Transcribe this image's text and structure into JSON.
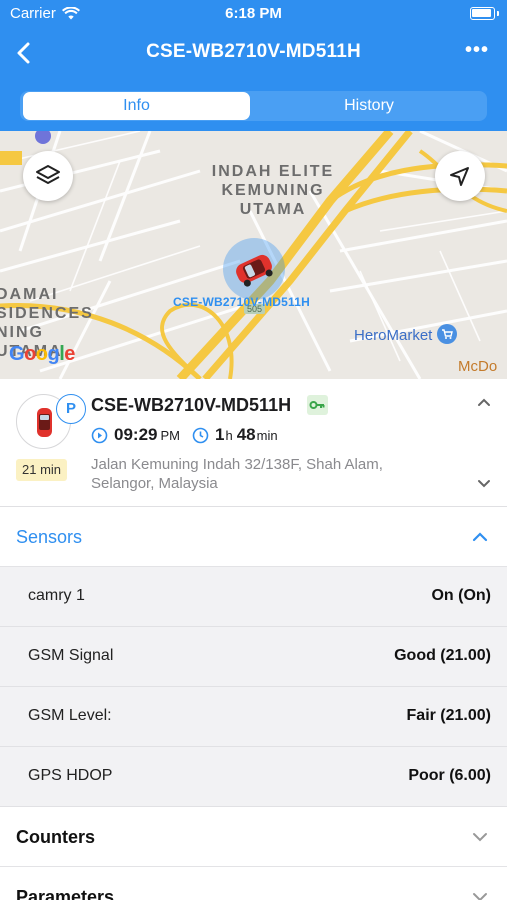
{
  "status_bar": {
    "carrier": "Carrier",
    "time": "6:18 PM"
  },
  "nav": {
    "title": "CSE-WB2710V-MD511H",
    "more": "•••"
  },
  "tabs": [
    {
      "label": "Info",
      "active": true
    },
    {
      "label": "History",
      "active": false
    }
  ],
  "map": {
    "area_a": "INDAH ELITE KEMUNING UTAMA",
    "area_b": "DAMAI SIDENCES NING UTAMA",
    "marker_label": "CSE-WB2710V-MD511H",
    "road_sign": "505",
    "poi_1": "HeroMarket",
    "poi_2": "McDo",
    "attribution": "Google"
  },
  "object": {
    "name": "CSE-WB2710V-MD511H",
    "parking_badge": "P",
    "duration": "21 min",
    "time": "09:29",
    "time_suffix": "PM",
    "stop_hours": "1",
    "stop_hours_unit": "h",
    "stop_minutes": "48",
    "stop_minutes_unit": "min",
    "address": "Jalan Kemuning Indah 32/138F, Shah Alam, Selangor, Malaysia"
  },
  "sensors": {
    "title": "Sensors",
    "rows": [
      {
        "name": "camry 1",
        "value": "On (On)"
      },
      {
        "name": "GSM Signal",
        "value": "Good (21.00)"
      },
      {
        "name": "GSM Level:",
        "value": "Fair (21.00)"
      },
      {
        "name": "GPS HDOP",
        "value": "Poor (6.00)"
      }
    ]
  },
  "counters": {
    "title": "Counters"
  },
  "parameters": {
    "title": "Parameters"
  },
  "colors": {
    "accent": "#2f8ff0",
    "key_badge": "#dff2dc",
    "duration_badge": "#fbf1c3"
  }
}
